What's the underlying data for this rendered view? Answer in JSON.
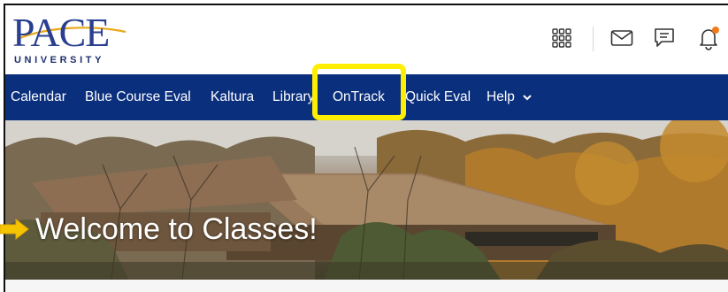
{
  "logo": {
    "word": "PACE",
    "sub": "UNIVERSITY"
  },
  "header_icons": [
    "apps-grid-icon",
    "mail-icon",
    "chat-icon",
    "bell-icon"
  ],
  "nav": {
    "items": [
      {
        "label": "Calendar"
      },
      {
        "label": "Blue Course Eval"
      },
      {
        "label": "Kaltura"
      },
      {
        "label": "Library"
      },
      {
        "label": "OnTrack"
      },
      {
        "label": "Quick Eval"
      },
      {
        "label": "Help"
      }
    ],
    "help_chevron": "⌄"
  },
  "hero": {
    "title": "Welcome to Classes!"
  },
  "colors": {
    "nav_bg": "#0a2f7d",
    "highlight": "#ffee00",
    "notification_dot": "#f07a1a",
    "logo_blue": "#2a3f8f"
  }
}
